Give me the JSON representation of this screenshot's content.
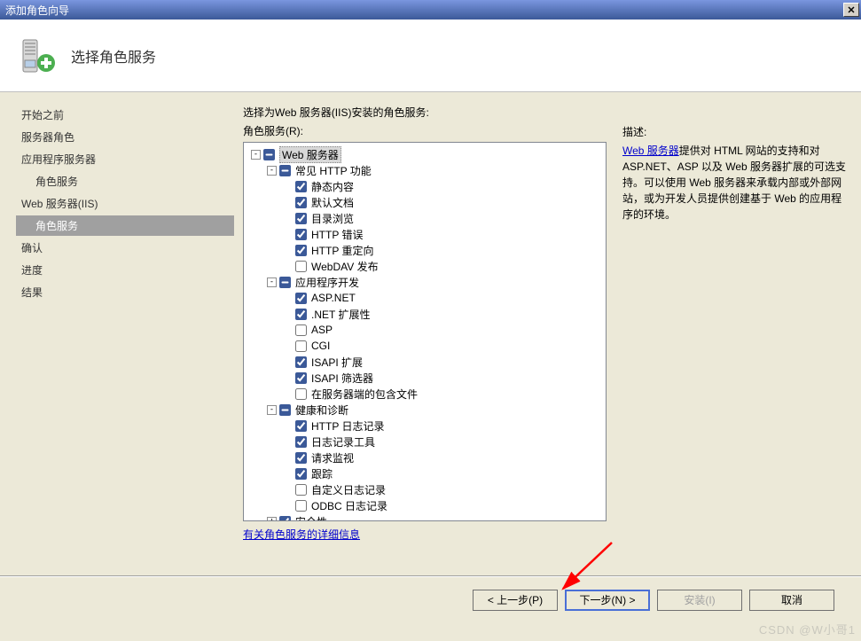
{
  "window": {
    "title": "添加角色向导"
  },
  "header": {
    "title": "选择角色服务"
  },
  "sidebar": {
    "items": [
      {
        "label": "开始之前"
      },
      {
        "label": "服务器角色"
      },
      {
        "label": "应用程序服务器"
      },
      {
        "label": "角色服务",
        "indent": true
      },
      {
        "label": "Web 服务器(IIS)"
      },
      {
        "label": "角色服务",
        "selected": true
      },
      {
        "label": "确认"
      },
      {
        "label": "进度"
      },
      {
        "label": "结果"
      }
    ]
  },
  "center": {
    "prompt": "选择为Web 服务器(IIS)安装的角色服务:",
    "list_label": "角色服务(R):",
    "more_info": "有关角色服务的详细信息"
  },
  "tree": [
    {
      "depth": 0,
      "toggle": "-",
      "state": "partial",
      "label": "Web 服务器",
      "selected": true
    },
    {
      "depth": 1,
      "toggle": "-",
      "state": "partial",
      "label": "常见 HTTP 功能"
    },
    {
      "depth": 2,
      "state": "checked",
      "label": "静态内容"
    },
    {
      "depth": 2,
      "state": "checked",
      "label": "默认文档"
    },
    {
      "depth": 2,
      "state": "checked",
      "label": "目录浏览"
    },
    {
      "depth": 2,
      "state": "checked",
      "label": "HTTP 错误"
    },
    {
      "depth": 2,
      "state": "checked",
      "label": "HTTP 重定向"
    },
    {
      "depth": 2,
      "state": "unchecked",
      "label": "WebDAV 发布"
    },
    {
      "depth": 1,
      "toggle": "-",
      "state": "partial",
      "label": "应用程序开发"
    },
    {
      "depth": 2,
      "state": "checked",
      "label": "ASP.NET"
    },
    {
      "depth": 2,
      "state": "checked",
      "label": ".NET 扩展性"
    },
    {
      "depth": 2,
      "state": "unchecked",
      "label": "ASP"
    },
    {
      "depth": 2,
      "state": "unchecked",
      "label": "CGI"
    },
    {
      "depth": 2,
      "state": "checked",
      "label": "ISAPI 扩展"
    },
    {
      "depth": 2,
      "state": "checked",
      "label": "ISAPI 筛选器"
    },
    {
      "depth": 2,
      "state": "unchecked",
      "label": "在服务器端的包含文件"
    },
    {
      "depth": 1,
      "toggle": "-",
      "state": "partial",
      "label": "健康和诊断"
    },
    {
      "depth": 2,
      "state": "checked",
      "label": "HTTP 日志记录"
    },
    {
      "depth": 2,
      "state": "checked",
      "label": "日志记录工具"
    },
    {
      "depth": 2,
      "state": "checked",
      "label": "请求监视"
    },
    {
      "depth": 2,
      "state": "checked",
      "label": "跟踪"
    },
    {
      "depth": 2,
      "state": "unchecked",
      "label": "自定义日志记录"
    },
    {
      "depth": 2,
      "state": "unchecked",
      "label": "ODBC 日志记录"
    },
    {
      "depth": 1,
      "toggle": "+",
      "state": "checked",
      "label": "安全性"
    }
  ],
  "description": {
    "title": "描述:",
    "link_text": "Web 服务器",
    "body": "提供对 HTML 网站的支持和对 ASP.NET、ASP 以及 Web 服务器扩展的可选支持。可以使用 Web 服务器来承载内部或外部网站，或为开发人员提供创建基于 Web 的应用程序的环境。"
  },
  "buttons": {
    "prev": "< 上一步(P)",
    "next": "下一步(N) >",
    "install": "安装(I)",
    "cancel": "取消"
  },
  "watermark": "CSDN @W小哥1"
}
